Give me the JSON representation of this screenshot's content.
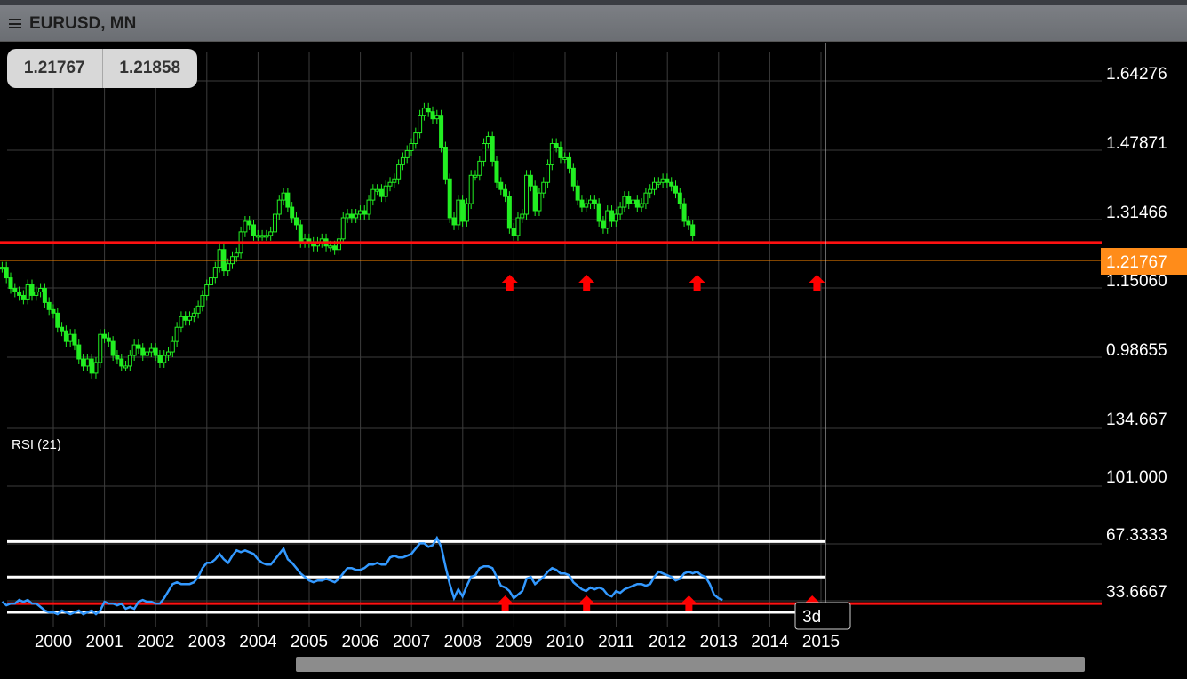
{
  "window": {
    "title": "EURUSD, MN"
  },
  "quotes": {
    "bid": "1.21767",
    "ask": "1.21858"
  },
  "colors": {
    "background": "#000000",
    "grid": "#3c3c3c",
    "candle_up": "#22ee22",
    "rsi_line": "#3399ff",
    "support_line": "#ff1111",
    "bid_line": "#ff8800",
    "arrow": "#ff0000",
    "level_line": "#ffffff",
    "price_tag": "#ff8c1a"
  },
  "chart_data": [
    {
      "type": "candlestick",
      "symbol": "EURUSD",
      "timeframe": "MN",
      "x_ticks": [
        "2000",
        "2001",
        "2002",
        "2003",
        "2004",
        "2005",
        "2006",
        "2007",
        "2008",
        "2009",
        "2010",
        "2011",
        "2012",
        "2013",
        "2014",
        "2015"
      ],
      "y_ticks": [
        "1.64276",
        "1.47871",
        "1.31466",
        "1.15060",
        "0.98655"
      ],
      "ylim": [
        0.87,
        1.68
      ],
      "current_price": "1.21767",
      "support_level": 1.2,
      "close_series": {
        "start_year": 1999.0,
        "step": 0.0833,
        "values": [
          1.13,
          1.1,
          1.07,
          1.06,
          1.05,
          1.04,
          1.08,
          1.05,
          1.06,
          1.07,
          1.03,
          1.01,
          1.0,
          0.96,
          0.95,
          0.92,
          0.94,
          0.91,
          0.87,
          0.85,
          0.87,
          0.83,
          0.86,
          0.94,
          0.93,
          0.92,
          0.88,
          0.87,
          0.85,
          0.85,
          0.88,
          0.91,
          0.9,
          0.88,
          0.89,
          0.9,
          0.88,
          0.86,
          0.88,
          0.89,
          0.92,
          0.96,
          0.99,
          0.98,
          0.99,
          1.0,
          1.02,
          1.05,
          1.08,
          1.1,
          1.13,
          1.18,
          1.12,
          1.14,
          1.16,
          1.17,
          1.23,
          1.26,
          1.25,
          1.22,
          1.22,
          1.22,
          1.22,
          1.23,
          1.28,
          1.32,
          1.34,
          1.3,
          1.27,
          1.25,
          1.2,
          1.21,
          1.2,
          1.19,
          1.2,
          1.21,
          1.19,
          1.19,
          1.18,
          1.21,
          1.27,
          1.28,
          1.27,
          1.28,
          1.29,
          1.28,
          1.32,
          1.35,
          1.35,
          1.33,
          1.36,
          1.37,
          1.38,
          1.42,
          1.44,
          1.46,
          1.48,
          1.51,
          1.56,
          1.58,
          1.57,
          1.55,
          1.56,
          1.47,
          1.38,
          1.27,
          1.25,
          1.32,
          1.26,
          1.31,
          1.39,
          1.39,
          1.43,
          1.48,
          1.5,
          1.43,
          1.37,
          1.35,
          1.33,
          1.24,
          1.22,
          1.27,
          1.28,
          1.39,
          1.36,
          1.29,
          1.34,
          1.37,
          1.42,
          1.48,
          1.47,
          1.44,
          1.44,
          1.41,
          1.36,
          1.32,
          1.3,
          1.31,
          1.32,
          1.31,
          1.26,
          1.24,
          1.29,
          1.26,
          1.28,
          1.3,
          1.33,
          1.31,
          1.32,
          1.3,
          1.31,
          1.34,
          1.35,
          1.37,
          1.37,
          1.38,
          1.37,
          1.36,
          1.34,
          1.31,
          1.26,
          1.25,
          1.22
        ]
      },
      "markers": [
        {
          "year": 2008.92,
          "type": "up-arrow"
        },
        {
          "year": 2010.42,
          "type": "up-arrow"
        },
        {
          "year": 2012.58,
          "type": "up-arrow"
        },
        {
          "year": 2014.92,
          "type": "up-arrow"
        }
      ]
    },
    {
      "type": "line",
      "title": "RSI (21)",
      "y_ticks": [
        "134.667",
        "101.000",
        "67.3333",
        "33.6667"
      ],
      "ylim": [
        28,
        140
      ],
      "levels": [
        70,
        50,
        35,
        30
      ],
      "support_level": 35,
      "series": [
        {
          "start_year": 1999.0,
          "step": 0.0833,
          "values": [
            36,
            34,
            35,
            35,
            37,
            36,
            37,
            35,
            35,
            33,
            31,
            30,
            30,
            29,
            31,
            30,
            29,
            30,
            31,
            29,
            30,
            31,
            29,
            31,
            36,
            35,
            35,
            34,
            35,
            32,
            33,
            32,
            36,
            37,
            36,
            36,
            35,
            35,
            38,
            42,
            46,
            47,
            46,
            46,
            46,
            47,
            50,
            55,
            58,
            58,
            60,
            63,
            60,
            58,
            62,
            65,
            64,
            65,
            64,
            63,
            60,
            58,
            57,
            57,
            60,
            63,
            66,
            60,
            58,
            55,
            52,
            50,
            48,
            47,
            48,
            48,
            49,
            48,
            47,
            49,
            52,
            55,
            55,
            54,
            54,
            55,
            57,
            57,
            58,
            57,
            57,
            61,
            62,
            61,
            61,
            62,
            63,
            66,
            69,
            69,
            67,
            68,
            72,
            67,
            56,
            46,
            38,
            43,
            39,
            45,
            50,
            51,
            55,
            56,
            56,
            55,
            50,
            45,
            44,
            42,
            38,
            40,
            42,
            49,
            50,
            46,
            48,
            50,
            53,
            55,
            54,
            52,
            52,
            51,
            47,
            45,
            43,
            42,
            44,
            43,
            44,
            43,
            40,
            39,
            42,
            41,
            43,
            44,
            45,
            46,
            46,
            45,
            46,
            50,
            53,
            52,
            51,
            50,
            48,
            49,
            52,
            53,
            52,
            53,
            51,
            50,
            46,
            40,
            38,
            37
          ]
        }
      ],
      "markers": [
        {
          "year": 2008.83,
          "type": "up-arrow"
        },
        {
          "year": 2010.42,
          "type": "up-arrow"
        },
        {
          "year": 2012.42,
          "type": "up-arrow"
        },
        {
          "year": 2014.83,
          "type": "up-arrow"
        }
      ],
      "crosshair_label": "3d"
    }
  ]
}
